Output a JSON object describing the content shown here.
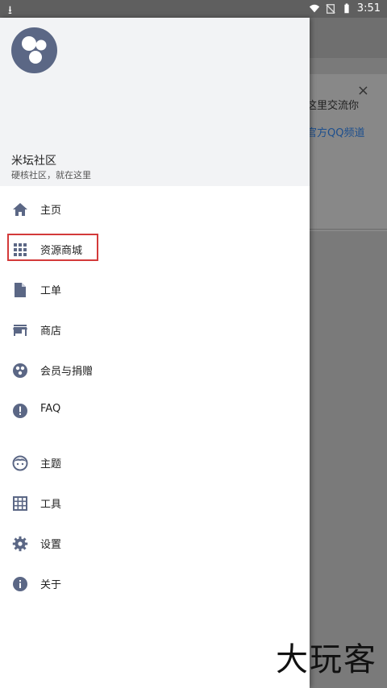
{
  "status_bar": {
    "time": "3:51"
  },
  "background_page": {
    "text_line1": "这里交流你",
    "text_line2": "官方QQ频道",
    "close_glyph": "×"
  },
  "drawer": {
    "title": "米坛社区",
    "subtitle": "硬核社区，就在这里",
    "items": [
      {
        "label": "主页",
        "icon": "home-icon"
      },
      {
        "label": "资源商城",
        "icon": "apps-grid-icon"
      },
      {
        "label": "工单",
        "icon": "document-icon"
      },
      {
        "label": "商店",
        "icon": "store-icon"
      },
      {
        "label": "会员与捐赠",
        "icon": "palette-icon"
      },
      {
        "label": "FAQ",
        "icon": "alert-circle-icon"
      },
      {
        "label": "主题",
        "icon": "face-icon"
      },
      {
        "label": "工具",
        "icon": "table-grid-icon"
      },
      {
        "label": "设置",
        "icon": "gear-icon"
      },
      {
        "label": "关于",
        "icon": "info-icon"
      }
    ]
  },
  "watermark": {
    "text": "大玩客"
  },
  "colors": {
    "icon": "#5b6785",
    "highlight": "#d33a3a"
  }
}
